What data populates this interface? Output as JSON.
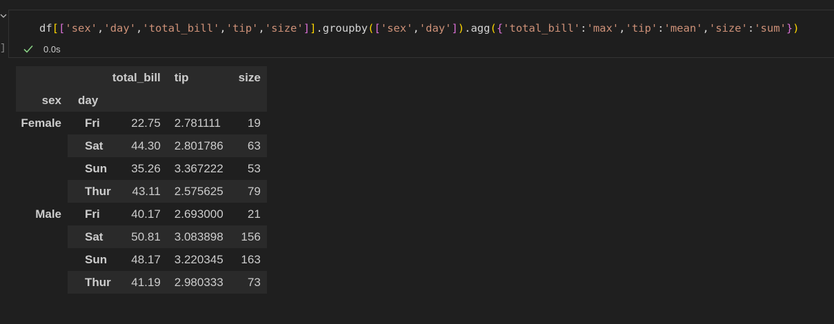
{
  "notebook": {
    "cell": {
      "code_tokens": [
        {
          "t": "df",
          "c": "#d4d4d4"
        },
        {
          "t": "[",
          "c": "#ffd700"
        },
        {
          "t": "[",
          "c": "#da70d6"
        },
        {
          "t": "'sex'",
          "c": "#ce9178"
        },
        {
          "t": ",",
          "c": "#d4d4d4"
        },
        {
          "t": "'day'",
          "c": "#ce9178"
        },
        {
          "t": ",",
          "c": "#d4d4d4"
        },
        {
          "t": "'total_bill'",
          "c": "#ce9178"
        },
        {
          "t": ",",
          "c": "#d4d4d4"
        },
        {
          "t": "'tip'",
          "c": "#ce9178"
        },
        {
          "t": ",",
          "c": "#d4d4d4"
        },
        {
          "t": "'size'",
          "c": "#ce9178"
        },
        {
          "t": "]",
          "c": "#da70d6"
        },
        {
          "t": "]",
          "c": "#ffd700"
        },
        {
          "t": ".groupby",
          "c": "#d4d4d4"
        },
        {
          "t": "(",
          "c": "#ffd700"
        },
        {
          "t": "[",
          "c": "#da70d6"
        },
        {
          "t": "'sex'",
          "c": "#ce9178"
        },
        {
          "t": ",",
          "c": "#d4d4d4"
        },
        {
          "t": "'day'",
          "c": "#ce9178"
        },
        {
          "t": "]",
          "c": "#da70d6"
        },
        {
          "t": ")",
          "c": "#ffd700"
        },
        {
          "t": ".agg",
          "c": "#d4d4d4"
        },
        {
          "t": "(",
          "c": "#ffd700"
        },
        {
          "t": "{",
          "c": "#da70d6"
        },
        {
          "t": "'total_bill'",
          "c": "#ce9178"
        },
        {
          "t": ":",
          "c": "#d4d4d4"
        },
        {
          "t": "'max'",
          "c": "#ce9178"
        },
        {
          "t": ",",
          "c": "#d4d4d4"
        },
        {
          "t": "'tip'",
          "c": "#ce9178"
        },
        {
          "t": ":",
          "c": "#d4d4d4"
        },
        {
          "t": "'mean'",
          "c": "#ce9178"
        },
        {
          "t": ",",
          "c": "#d4d4d4"
        },
        {
          "t": "'size'",
          "c": "#ce9178"
        },
        {
          "t": ":",
          "c": "#d4d4d4"
        },
        {
          "t": "'sum'",
          "c": "#ce9178"
        },
        {
          "t": "}",
          "c": "#da70d6"
        },
        {
          "t": ")",
          "c": "#ffd700"
        }
      ],
      "status_icon": "check-icon",
      "status_color": "#89d185",
      "exec_time": "0.0s",
      "gutter_bracket": "]"
    },
    "output": {
      "columns": [
        "total_bill",
        "tip",
        "size"
      ],
      "index_names": [
        "sex",
        "day"
      ],
      "groups": [
        {
          "sex": "Female",
          "rows": [
            {
              "day": "Fri",
              "total_bill": "22.75",
              "tip": "2.781111",
              "size": "19"
            },
            {
              "day": "Sat",
              "total_bill": "44.30",
              "tip": "2.801786",
              "size": "63"
            },
            {
              "day": "Sun",
              "total_bill": "35.26",
              "tip": "3.367222",
              "size": "53"
            },
            {
              "day": "Thur",
              "total_bill": "43.11",
              "tip": "2.575625",
              "size": "79"
            }
          ]
        },
        {
          "sex": "Male",
          "rows": [
            {
              "day": "Fri",
              "total_bill": "40.17",
              "tip": "2.693000",
              "size": "21"
            },
            {
              "day": "Sat",
              "total_bill": "50.81",
              "tip": "3.083898",
              "size": "156"
            },
            {
              "day": "Sun",
              "total_bill": "48.17",
              "tip": "3.220345",
              "size": "163"
            },
            {
              "day": "Thur",
              "total_bill": "41.19",
              "tip": "2.980333",
              "size": "73"
            }
          ]
        }
      ]
    }
  }
}
